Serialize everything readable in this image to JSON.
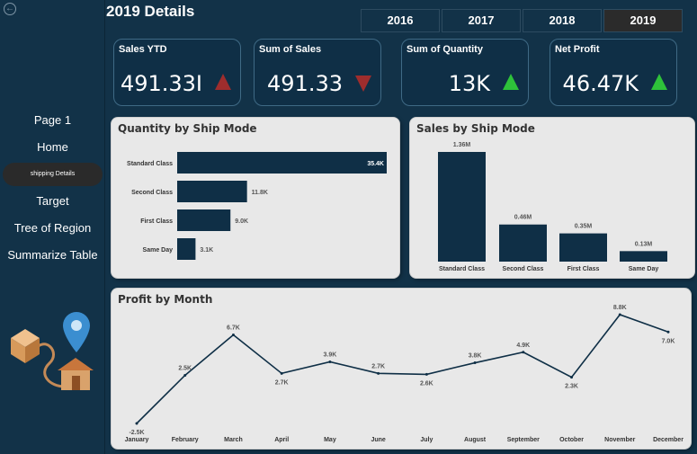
{
  "page_title": "2019 Details",
  "years": [
    "2016",
    "2017",
    "2018",
    "2019"
  ],
  "selected_year": "2019",
  "nav": {
    "items": [
      "Page 1",
      "Home",
      "shipping Details",
      "Target",
      "Tree of Region",
      "Summarize Table"
    ],
    "active_index": 2
  },
  "kpis": [
    {
      "label": "Sales YTD",
      "value": "491.33I",
      "trend": "up",
      "color": "#9e2d2d"
    },
    {
      "label": "Sum of Sales",
      "value": "491.33",
      "trend": "down",
      "color": "#9e2d2d"
    },
    {
      "label": "Sum of Quantity",
      "value": "13K",
      "trend": "up",
      "color": "#2ec23a"
    },
    {
      "label": "Net Profit",
      "value": "46.47K",
      "trend": "up",
      "color": "#2ec23a"
    }
  ],
  "colors": {
    "bar": "#0f2f46",
    "background": "#123248",
    "card": "#e8e8e8"
  },
  "chart_data": [
    {
      "type": "bar",
      "orientation": "horizontal",
      "title": "Quantity by Ship Mode",
      "categories": [
        "Standard Class",
        "Second Class",
        "First Class",
        "Same Day"
      ],
      "values": [
        35400,
        11800,
        9000,
        3100
      ],
      "data_labels": [
        "35.4K",
        "11.8K",
        "9.0K",
        "3.1K"
      ]
    },
    {
      "type": "bar",
      "orientation": "vertical",
      "title": "Sales by Ship Mode",
      "categories": [
        "Standard Class",
        "Second Class",
        "First Class",
        "Same Day"
      ],
      "values": [
        1.36,
        0.46,
        0.35,
        0.13
      ],
      "data_labels": [
        "1.36M",
        "0.46M",
        "0.35M",
        "0.13M"
      ]
    },
    {
      "type": "line",
      "title": "Profit by Month",
      "categories": [
        "January",
        "February",
        "March",
        "April",
        "May",
        "June",
        "July",
        "August",
        "September",
        "October",
        "November",
        "December"
      ],
      "values": [
        -2.5,
        2.5,
        6.7,
        2.7,
        3.9,
        2.7,
        2.6,
        3.8,
        4.9,
        2.3,
        8.8,
        7.0
      ],
      "data_labels": [
        "-2.5K",
        "2.5K",
        "6.7K",
        "2.7K",
        "3.9K",
        "2.7K",
        "2.6K",
        "3.8K",
        "4.9K",
        "2.3K",
        "8.8K",
        "7.0K"
      ]
    }
  ]
}
